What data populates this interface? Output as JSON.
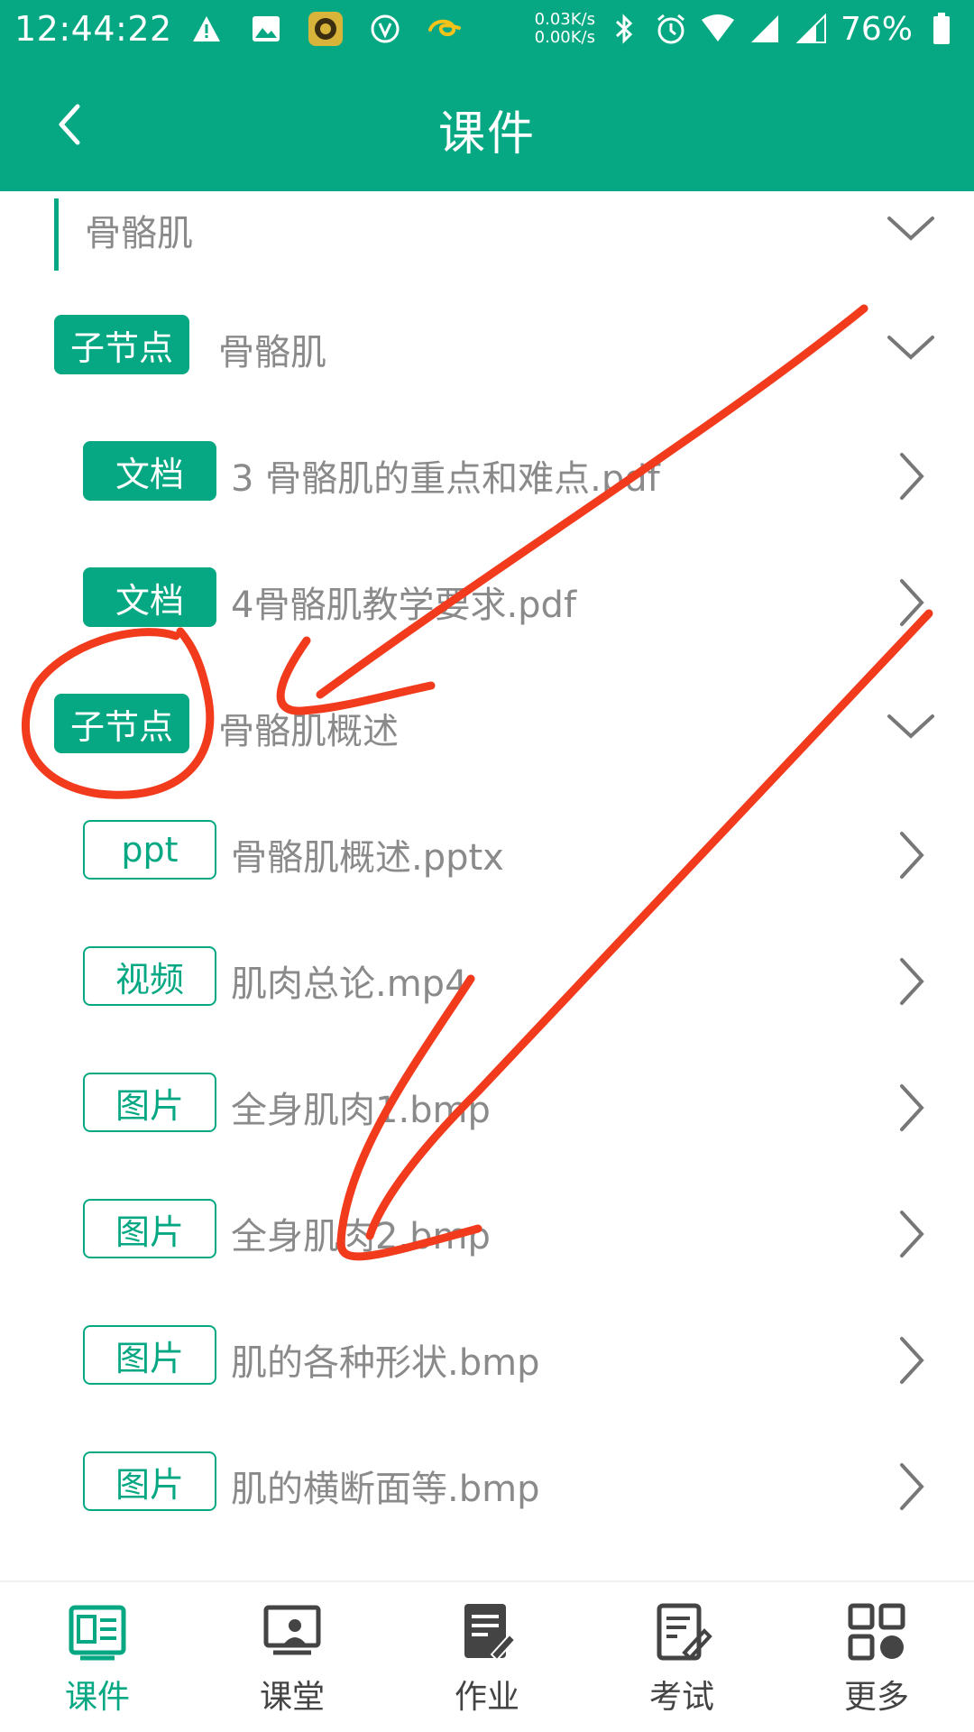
{
  "status_bar": {
    "time": "12:44:22",
    "net_up": "0.03K/s",
    "net_down": "0.00K/s",
    "battery": "76%"
  },
  "header": {
    "title": "课件"
  },
  "list": {
    "chapter": {
      "label": "骨骼肌"
    },
    "subnode_1": {
      "tag": "子节点",
      "label": "骨骼肌"
    },
    "doc_1": {
      "tag": "文档",
      "label": "3 骨骼肌的重点和难点.pdf"
    },
    "doc_2": {
      "tag": "文档",
      "label": "4骨骼肌教学要求.pdf"
    },
    "subnode_2": {
      "tag": "子节点",
      "label": "骨骼肌概述"
    },
    "ppt_1": {
      "tag": "ppt",
      "label": "骨骼肌概述.pptx"
    },
    "video_1": {
      "tag": "视频",
      "label": "肌肉总论.mp4"
    },
    "image_1": {
      "tag": "图片",
      "label": "全身肌肉1.bmp"
    },
    "image_2": {
      "tag": "图片",
      "label": "全身肌肉2.bmp"
    },
    "image_3": {
      "tag": "图片",
      "label": "肌的各种形状.bmp"
    },
    "image_4": {
      "tag": "图片",
      "label": "肌的横断面等.bmp"
    }
  },
  "tabs": [
    {
      "label": "课件",
      "icon": "courseware-icon",
      "active": true
    },
    {
      "label": "课堂",
      "icon": "classroom-icon",
      "active": false
    },
    {
      "label": "作业",
      "icon": "homework-icon",
      "active": false
    },
    {
      "label": "考试",
      "icon": "exam-icon",
      "active": false
    },
    {
      "label": "更多",
      "icon": "more-icon",
      "active": false
    }
  ],
  "colors": {
    "brand": "#05a882",
    "annotation": "#f23a1c",
    "muted_text": "#8a8a8a"
  }
}
